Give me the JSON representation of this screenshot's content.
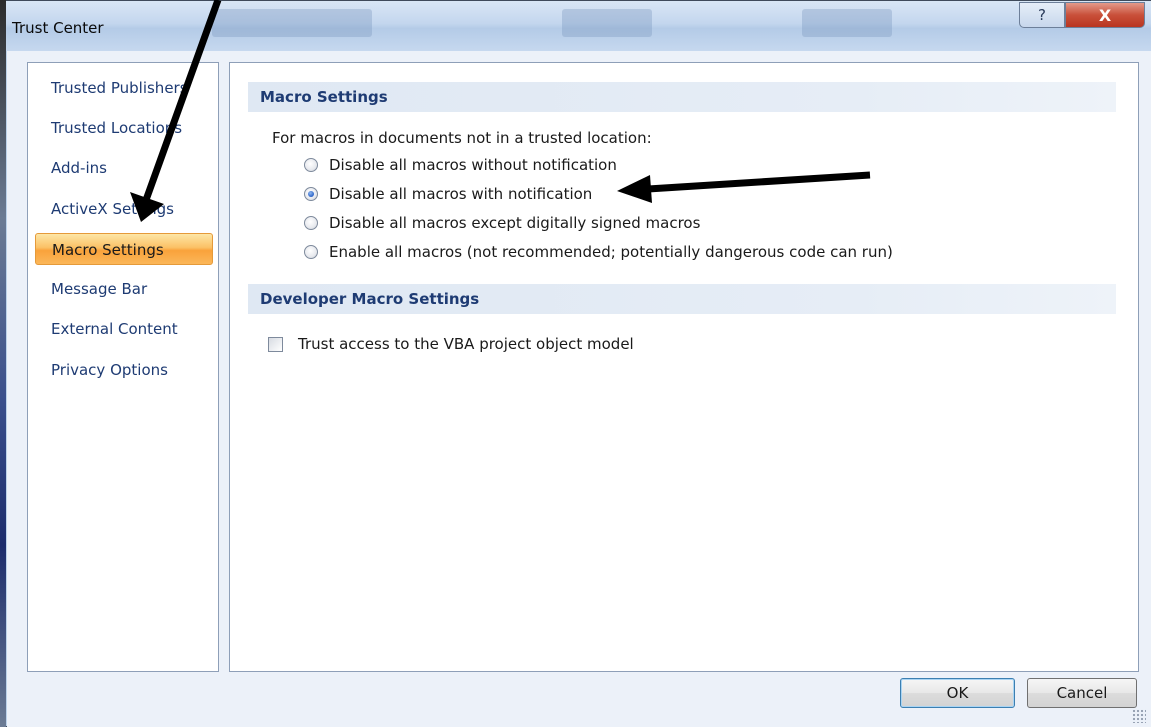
{
  "window": {
    "title": "Trust Center",
    "help_label": "?",
    "close_label": "X"
  },
  "sidebar": {
    "items": [
      {
        "label": "Trusted Publishers"
      },
      {
        "label": "Trusted Locations"
      },
      {
        "label": "Add-ins"
      },
      {
        "label": "ActiveX Settings"
      },
      {
        "label": "Macro Settings",
        "selected": true
      },
      {
        "label": "Message Bar"
      },
      {
        "label": "External Content"
      },
      {
        "label": "Privacy Options"
      }
    ]
  },
  "macro_settings": {
    "header": "Macro Settings",
    "intro": "For macros in documents not in a trusted location:",
    "options": [
      {
        "label": "Disable all macros without notification",
        "selected": false
      },
      {
        "label": "Disable all macros with notification",
        "selected": true
      },
      {
        "label": "Disable all macros except digitally signed macros",
        "selected": false
      },
      {
        "label": "Enable all macros (not recommended; potentially dangerous code can run)",
        "selected": false
      }
    ]
  },
  "developer_settings": {
    "header": "Developer Macro Settings",
    "vba_label": "Trust access to the VBA project object model",
    "vba_checked": false
  },
  "buttons": {
    "ok": "OK",
    "cancel": "Cancel"
  },
  "colors": {
    "selection_orange": "#f9a23b",
    "header_text": "#1e3b73",
    "annotation_arrow": "#000000"
  }
}
